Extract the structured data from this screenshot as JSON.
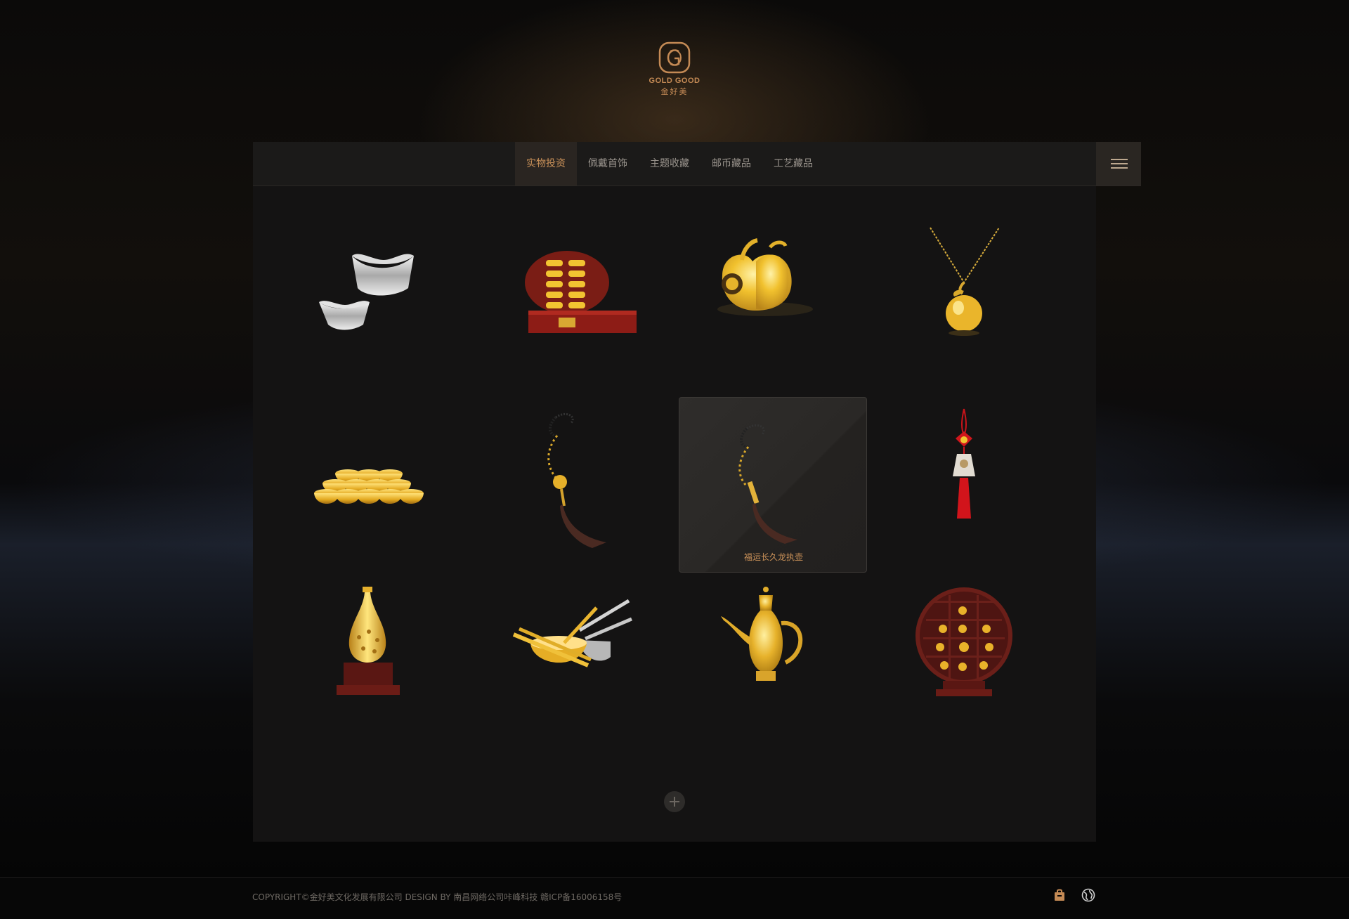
{
  "brand": {
    "name_en": "GOLD GOOD",
    "name_cn": "金好美"
  },
  "nav": {
    "items": [
      {
        "label": "实物投资",
        "active": true
      },
      {
        "label": "佩戴首饰",
        "active": false
      },
      {
        "label": "主题收藏",
        "active": false
      },
      {
        "label": "邮币藏品",
        "active": false
      },
      {
        "label": "工艺藏品",
        "active": false
      }
    ],
    "menu_icon": "hamburger-menu-icon"
  },
  "products": [
    {
      "icon": "silver-ingots"
    },
    {
      "icon": "gold-bars-in-box"
    },
    {
      "icon": "gold-apple-figurine"
    },
    {
      "icon": "gold-apple-necklace"
    },
    {
      "icon": "gold-cups-set"
    },
    {
      "icon": "tassel-pendant"
    },
    {
      "icon": "tassel-pendant",
      "label": "福运长久龙执壶",
      "hovered": true
    },
    {
      "icon": "red-knot-pendant"
    },
    {
      "icon": "gold-vase"
    },
    {
      "icon": "gold-bowl-chopsticks"
    },
    {
      "icon": "gold-ewer"
    },
    {
      "icon": "zodiac-display-stand"
    }
  ],
  "more_button": {
    "icon": "plus-icon"
  },
  "footer": {
    "copyright": "COPYRIGHT©金好美文化发展有限公司 DESIGN BY 南昌网络公司咔峰科技  赣ICP备16006158号",
    "icons": [
      "shop-bag-icon",
      "globe-icon"
    ]
  },
  "colors": {
    "accent": "#c89058",
    "panel": "#141313",
    "navbar": "#1b1a19"
  }
}
